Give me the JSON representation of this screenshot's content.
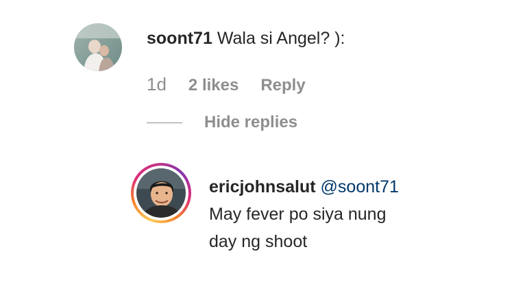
{
  "parent_comment": {
    "username": "soont71",
    "text": "Wala si Angel? ):",
    "time": "1d",
    "likes": "2 likes",
    "reply_label": "Reply",
    "hide_replies_label": "Hide replies"
  },
  "reply": {
    "username": "ericjohnsalut",
    "mention": "@soont71",
    "text_line1": "May fever po siya nung",
    "text_line2": "day ng shoot"
  },
  "colors": {
    "text_primary": "#262626",
    "text_secondary": "#8e8e8e",
    "mention": "#00376b",
    "story_ring_start": "#f58529",
    "story_ring_end": "#dd2a7b"
  },
  "icons": {
    "parent_avatar": "profile-photo",
    "reply_avatar": "profile-photo-with-story-ring"
  }
}
